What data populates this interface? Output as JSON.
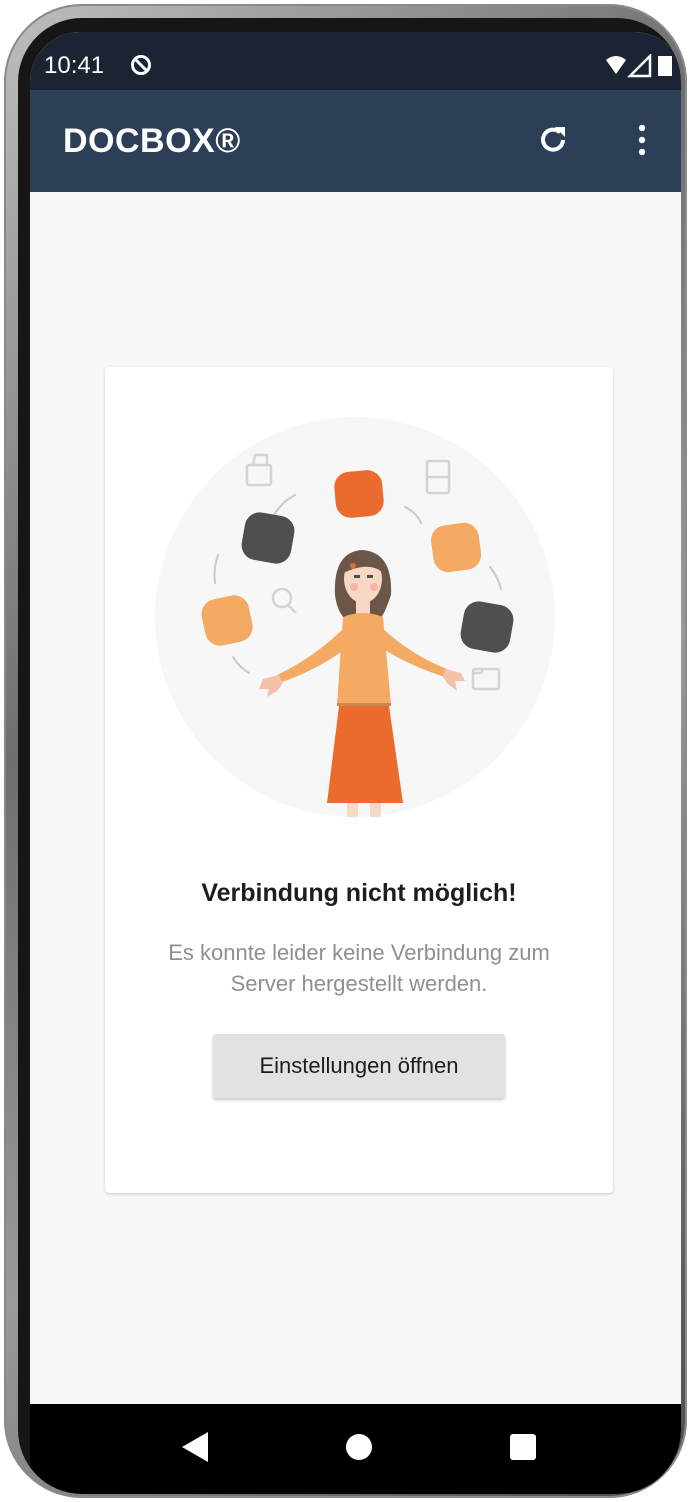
{
  "status_bar": {
    "time": "10:41",
    "icons": [
      "do-not-disturb-icon",
      "wifi-icon",
      "signal-icon",
      "battery-icon"
    ]
  },
  "app_bar": {
    "title": "DOCBOX®",
    "actions": [
      "refresh-icon",
      "more-vert-icon"
    ],
    "background_color": "#2c3f57"
  },
  "error_card": {
    "title": "Verbindung nicht möglich!",
    "message": "Es konnte leider keine Verbindung zum Server hergestellt werden.",
    "button_label": "Einstellungen öffnen"
  },
  "nav_bar": {
    "icons": [
      "back-icon",
      "home-icon",
      "recents-icon"
    ]
  },
  "colors": {
    "accent_orange": "#eb6a2e",
    "light_orange": "#f5aa63",
    "dark_gray": "#4f4f4f"
  }
}
